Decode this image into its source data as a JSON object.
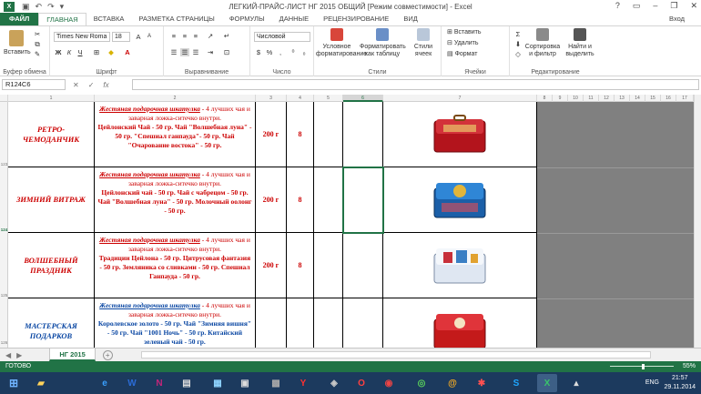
{
  "window": {
    "title": "ЛЕГКИЙ-ПРАЙС-ЛИСТ НГ 2015 ОБЩИЙ  [Режим совместимости] - Excel",
    "user": "Вход",
    "app_logo_text": "X"
  },
  "tabs": [
    {
      "label": "ФАЙЛ"
    },
    {
      "label": "ГЛАВНАЯ"
    },
    {
      "label": "ВСТАВКА"
    },
    {
      "label": "РАЗМЕТКА СТРАНИЦЫ"
    },
    {
      "label": "ФОРМУЛЫ"
    },
    {
      "label": "ДАННЫЕ"
    },
    {
      "label": "РЕЦЕНЗИРОВАНИЕ"
    },
    {
      "label": "ВИД"
    }
  ],
  "ribbon": {
    "clipboard": {
      "paste": "Вставить",
      "group": "Буфер обмена"
    },
    "font": {
      "name": "Times New Roma",
      "size": "18",
      "bold": "Ж",
      "italic": "К",
      "underline": "Ч",
      "group": "Шрифт"
    },
    "alignment": {
      "group": "Выравнивание"
    },
    "number": {
      "format": "Числовой",
      "group": "Число"
    },
    "styles": {
      "conditional": "Условное форматирование",
      "as_table": "Форматировать как таблицу",
      "cell_styles": "Стили ячеек",
      "group": "Стили"
    },
    "cells": {
      "insert": "Вставить",
      "delete": "Удалить",
      "format": "Формат",
      "group": "Ячейки"
    },
    "editing": {
      "sort": "Сортировка и фильтр",
      "find": "Найти и выделить",
      "group": "Редактирование"
    }
  },
  "formula_bar": {
    "name_box": "R124C6",
    "fx": "fx",
    "cancel": "✕",
    "enter": "✓",
    "value": ""
  },
  "columns": [
    "1",
    "2",
    "3",
    "4",
    "5",
    "6",
    "7",
    "8",
    "9",
    "10",
    "11",
    "12",
    "13",
    "14",
    "15",
    "16",
    "17"
  ],
  "rows_header": [
    "123",
    "124",
    "125",
    "126"
  ],
  "products": [
    {
      "name": "РЕТРО-ЧЕМОДАНЧИК",
      "color": "red",
      "lead": "Жестяная подарочная шкатулка",
      "rest": " - 4 лучших чая и заварная ложка-ситечко внутри.",
      "teas": "Цейлонский Чай - 50 гр. Чай \"Волшебная луна\" - 50 гр. \"Спешиал ганпауда\"- 50 гр. Чай \"Очарование востока\" - 50 гр.",
      "weight": "200 г",
      "qty": "8",
      "tin_color": "#b3141c"
    },
    {
      "name": "ЗИМНИЙ ВИТРАЖ",
      "color": "red",
      "lead": "Жестяная подарочная шкатулка",
      "rest": " - 4 лучших чая и заварная ложка-ситечко внутри.",
      "teas": "Цейлонский чай - 50 гр. Чай с чабрецом - 50 гр. Чай \"Волшебная луна\" - 50 гр. Молочный оолонг - 50 гр.",
      "weight": "200 г",
      "qty": "8",
      "tin_color": "#1b5fa8"
    },
    {
      "name": "ВОЛШЕБНЫЙ ПРАЗДНИК",
      "color": "red",
      "lead": "Жестяная подарочная шкатулка",
      "rest": " - 4 лучших чая и заварная ложка-ситечко внутри.",
      "teas": "Традиции Цейлона - 50 гр. Цитрусовая фантазия - 50 гр. Земляника со сливками - 50 гр. Спешиал Ганпауда - 50 гр.",
      "weight": "200 г",
      "qty": "8",
      "tin_color": "#e8eef6"
    },
    {
      "name": "МАСТЕРСКАЯ ПОДАРКОВ",
      "color": "blue",
      "lead": "Жестяная подарочная шкатулка",
      "rest": " - 4 лучших чая и заварная ложка-ситечко внутри.",
      "teas": "Королевское золото - 50 гр. Чай \"Зимняя вишня\" - 50 гр. Чай \"1001 Ночь\" - 50 гр. Китайский зеленый чай - 50 гр.",
      "weight": "",
      "qty": "",
      "tin_color": "#c41a1a"
    }
  ],
  "sheet_tab": "НГ 2015",
  "status": {
    "ready": "ГОТОВО",
    "zoom": "55%"
  },
  "taskbar": {
    "lang": "ENG",
    "time": "21:57",
    "date": "29.11.2014"
  }
}
